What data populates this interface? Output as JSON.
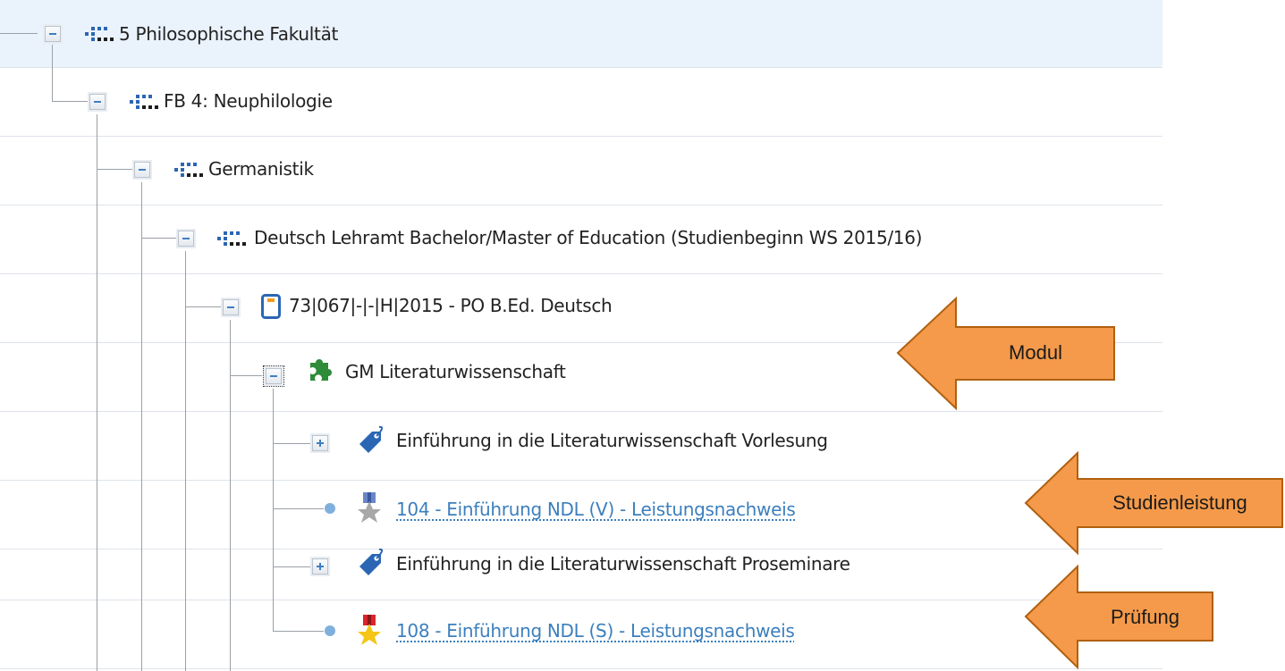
{
  "tree": {
    "nodes": [
      {
        "label": "5 Philosophische Fakultät",
        "type": "org-unit",
        "expanded": true,
        "selected": true
      },
      {
        "label": "FB 4: Neuphilologie",
        "type": "org-unit",
        "expanded": true
      },
      {
        "label": "Germanistik",
        "type": "org-unit",
        "expanded": true
      },
      {
        "label": "Deutsch Lehramt Bachelor/Master of Education (Studienbeginn WS 2015/16)",
        "type": "org-unit",
        "expanded": true
      },
      {
        "label": "73|067|-|-|H|2015 - PO B.Ed. Deutsch",
        "type": "exam-regulation",
        "expanded": true
      },
      {
        "label": "GM Literaturwissenschaft",
        "type": "module",
        "expanded": true,
        "focused": true
      },
      {
        "label": "Einführung in die Literaturwissenschaft Vorlesung",
        "type": "course-tag",
        "expanded": false
      },
      {
        "label": "104 - Einführung NDL (V) - Leistungsnachweis",
        "type": "achievement-link",
        "medal": "grey"
      },
      {
        "label": "Einführung in die Literaturwissenschaft Proseminare",
        "type": "course-tag",
        "expanded": false
      },
      {
        "label": "108 - Einführung NDL (S) - Leistungsnachweis",
        "type": "achievement-link",
        "medal": "gold"
      }
    ]
  },
  "callouts": {
    "modul": "Modul",
    "studienleistung": "Studienleistung",
    "pruefung": "Prüfung"
  },
  "colors": {
    "callout_fill": "#f59a4a",
    "callout_stroke": "#b06010",
    "link": "#3c7fbd",
    "selected_row": "#eaf2fb",
    "module_icon": "#2e8b3a"
  }
}
